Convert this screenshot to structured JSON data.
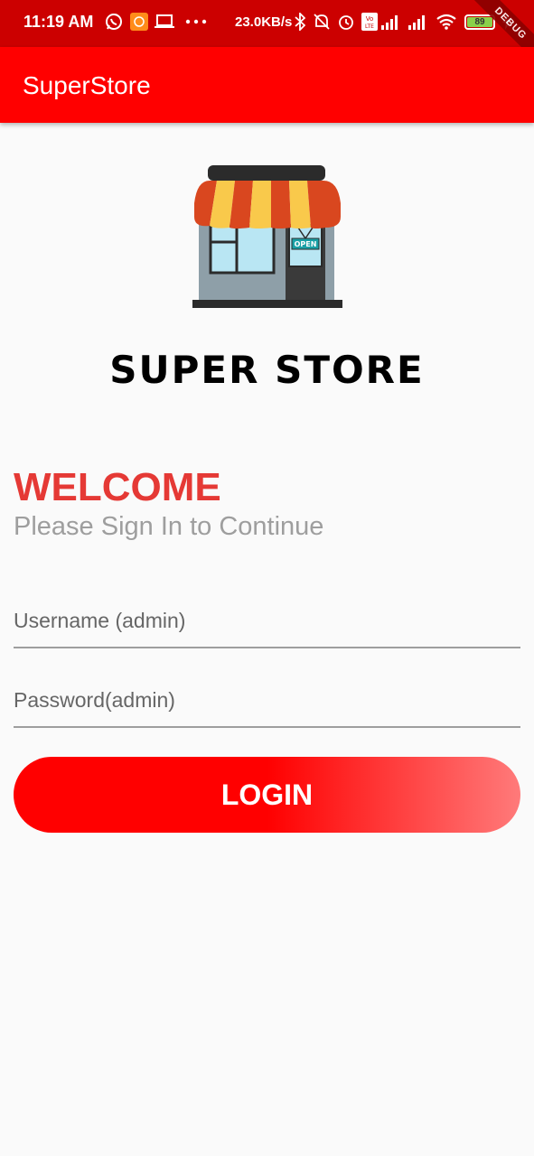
{
  "status_bar": {
    "time": "11:19 AM",
    "network_speed": "23.0KB/s",
    "battery_level": "89",
    "debug_label": "DEBUG",
    "icons": [
      "whatsapp-icon",
      "app-notification-icon",
      "laptop-icon",
      "more-dots-icon",
      "bluetooth-icon",
      "mute-icon",
      "alarm-icon",
      "volte-icon",
      "signal-icon",
      "signal-icon",
      "wifi-icon",
      "battery-icon",
      "charging-icon"
    ]
  },
  "app_bar": {
    "title": "SuperStore",
    "color": "#ff0000"
  },
  "logo": {
    "icon": "store-front-icon",
    "sign_text": "OPEN",
    "brand_name": "SUPER STORE"
  },
  "welcome": {
    "heading": "WELCOME",
    "subtitle": "Please Sign In to Continue",
    "heading_color": "#e53935"
  },
  "form": {
    "username_placeholder": "Username (admin)",
    "password_placeholder": "Password(admin)",
    "login_label": "LOGIN"
  }
}
